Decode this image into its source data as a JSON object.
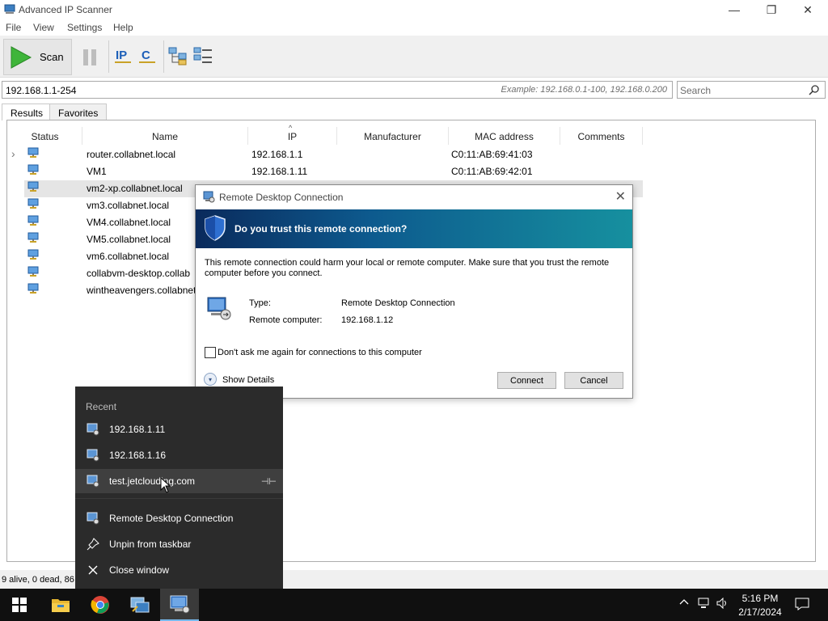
{
  "window": {
    "title": "Advanced IP Scanner",
    "controls": {
      "minimize": "—",
      "maximize": "❐",
      "close": "✕"
    }
  },
  "menu": [
    "File",
    "View",
    "Settings",
    "Help"
  ],
  "toolbar": {
    "scan_label": "Scan",
    "ip_icon_label": "IP",
    "c_icon_label": "C"
  },
  "address": {
    "range_value": "192.168.1.1-254",
    "example": "Example: 192.168.0.1-100, 192.168.0.200",
    "search_placeholder": "Search"
  },
  "tabs": [
    "Results",
    "Favorites"
  ],
  "table": {
    "columns": [
      "Status",
      "Name",
      "IP",
      "Manufacturer",
      "MAC address",
      "Comments"
    ],
    "sort_indicator": "^",
    "rows": [
      {
        "name": "router.collabnet.local",
        "ip": "192.168.1.1",
        "mac": "C0:11:AB:69:41:03",
        "expander": "›"
      },
      {
        "name": "VM1",
        "ip": "192.168.1.11",
        "mac": "C0:11:AB:69:42:01",
        "expander": ""
      },
      {
        "name": "vm2-xp.collabnet.local",
        "ip": "",
        "mac": "",
        "expander": ""
      },
      {
        "name": "vm3.collabnet.local",
        "ip": "",
        "mac": "",
        "expander": ""
      },
      {
        "name": "VM4.collabnet.local",
        "ip": "",
        "mac": "",
        "expander": ""
      },
      {
        "name": "VM5.collabnet.local",
        "ip": "",
        "mac": "",
        "expander": ""
      },
      {
        "name": "vm6.collabnet.local",
        "ip": "",
        "mac": "",
        "expander": ""
      },
      {
        "name": "collabvm-desktop.collab",
        "ip": "",
        "mac": "",
        "expander": ""
      },
      {
        "name": "wintheavengers.collabnet",
        "ip": "",
        "mac": "",
        "expander": ""
      }
    ]
  },
  "status": {
    "text": "9 alive, 0 dead, 86"
  },
  "dialog": {
    "title": "Remote Desktop Connection",
    "close": "✕",
    "banner": "Do you trust this remote connection?",
    "warning": "This remote connection could harm your local or remote computer. Make sure that you trust the remote computer before you connect.",
    "type_label": "Type:",
    "type_value": "Remote Desktop Connection",
    "computer_label": "Remote computer:",
    "computer_value": "192.168.1.12",
    "checkbox_label": "Don't ask me again for connections to this computer",
    "show_details": "Show Details",
    "show_details_icon": "▾",
    "connect": "Connect",
    "cancel": "Cancel"
  },
  "jumplist": {
    "recent_label": "Recent",
    "recent": [
      "192.168.1.11",
      "192.168.1.16",
      "test.jetclouding.com"
    ],
    "pin_glyph": "⊣⊢",
    "tasks": [
      "Remote Desktop Connection",
      "Unpin from taskbar",
      "Close window"
    ]
  },
  "taskbar": {
    "time": "5:16 PM",
    "date": "2/17/2024"
  },
  "colors": {
    "banner_start": "#0a2a5c",
    "banner_end": "#16909f",
    "selected_row": "#e5e5e5",
    "taskbar": "#101010",
    "jumplist": "#2b2b2b"
  }
}
